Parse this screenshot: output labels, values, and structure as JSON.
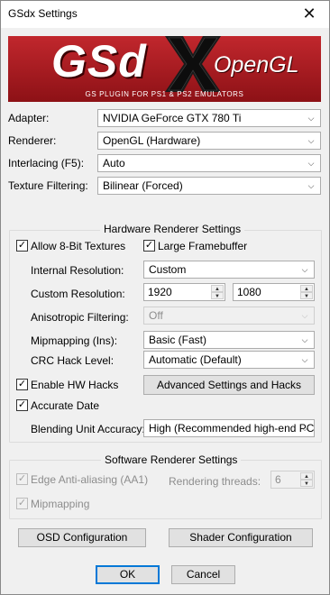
{
  "window": {
    "title": "GSdx Settings",
    "close_glyph": "✕"
  },
  "banner": {
    "title_left": "GSd",
    "title_right": "OpenGL",
    "subtitle": "GS PLUGIN FOR PS1 & PS2 EMULATORS"
  },
  "main": {
    "adapter_label": "Adapter:",
    "adapter_value": "NVIDIA GeForce GTX 780 Ti",
    "renderer_label": "Renderer:",
    "renderer_value": "OpenGL (Hardware)",
    "interlacing_label": "Interlacing (F5):",
    "interlacing_value": "Auto",
    "texture_filtering_label": "Texture Filtering:",
    "texture_filtering_value": "Bilinear (Forced)"
  },
  "hw": {
    "title": "Hardware Renderer Settings",
    "allow_8bit_label": "Allow 8-Bit Textures",
    "allow_8bit_checked": true,
    "large_fb_label": "Large Framebuffer",
    "large_fb_checked": true,
    "internal_res_label": "Internal Resolution:",
    "internal_res_value": "Custom",
    "custom_res_label": "Custom Resolution:",
    "custom_res_width": "1920",
    "custom_res_height": "1080",
    "aniso_label": "Anisotropic Filtering:",
    "aniso_value": "Off",
    "mipmap_label": "Mipmapping (Ins):",
    "mipmap_value": "Basic (Fast)",
    "crc_label": "CRC Hack Level:",
    "crc_value": "Automatic (Default)",
    "enable_hw_hacks_label": "Enable HW Hacks",
    "enable_hw_hacks_checked": true,
    "advanced_button": "Advanced Settings and Hacks",
    "accurate_date_label": "Accurate Date",
    "accurate_date_checked": true,
    "blending_label": "Blending Unit Accuracy:",
    "blending_value": "High (Recommended high-end PC)"
  },
  "sw": {
    "title": "Software Renderer Settings",
    "edge_aa_label": "Edge Anti-aliasing (AA1)",
    "edge_aa_checked": true,
    "threads_label": "Rendering threads:",
    "threads_value": "6",
    "mipmapping_label": "Mipmapping",
    "mipmapping_checked": true
  },
  "buttons": {
    "osd": "OSD Configuration",
    "shader": "Shader Configuration",
    "ok": "OK",
    "cancel": "Cancel"
  },
  "icons": {
    "check": "✓",
    "dropdown": "chevron-down-icon",
    "spin_up": "▲",
    "spin_down": "▼",
    "combo_arrow": "⌵"
  },
  "colors": {
    "banner_red": "#c1272d",
    "default_button_border": "#0078d7"
  }
}
